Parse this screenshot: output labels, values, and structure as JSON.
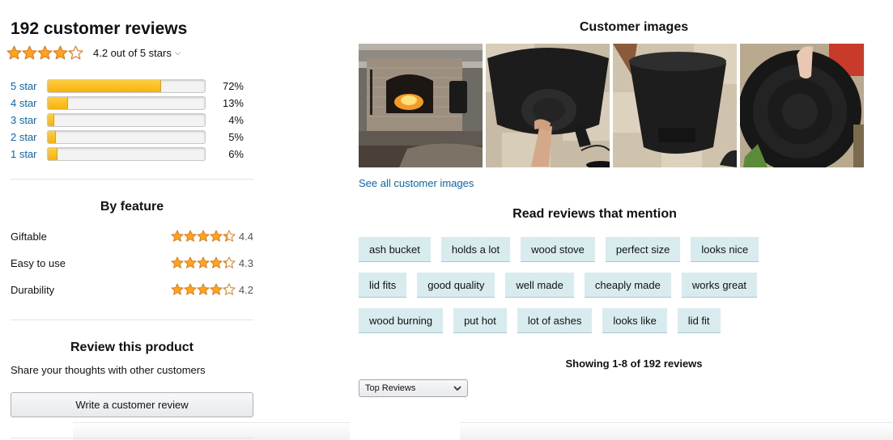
{
  "summary": {
    "total_reviews": "192 customer reviews",
    "rating_text": "4.2 out of 5 stars",
    "rating_stars": 4.2
  },
  "histogram": [
    {
      "label": "5 star",
      "percent_text": "72%",
      "fraction": 0.72
    },
    {
      "label": "4 star",
      "percent_text": "13%",
      "fraction": 0.13
    },
    {
      "label": "3 star",
      "percent_text": "4%",
      "fraction": 0.04
    },
    {
      "label": "2 star",
      "percent_text": "5%",
      "fraction": 0.05
    },
    {
      "label": "1 star",
      "percent_text": "6%",
      "fraction": 0.06
    }
  ],
  "by_feature": {
    "title": "By feature",
    "items": [
      {
        "name": "Giftable",
        "value": "4.4",
        "stars": 4.4
      },
      {
        "name": "Easy to use",
        "value": "4.3",
        "stars": 4.3
      },
      {
        "name": "Durability",
        "value": "4.2",
        "stars": 4.2
      }
    ]
  },
  "review_product": {
    "title": "Review this product",
    "subtitle": "Share your thoughts with other customers",
    "button_label": "Write a customer review"
  },
  "customer_images": {
    "title": "Customer images",
    "see_all": "See all customer images",
    "images": [
      "fireplace-photo",
      "bucket-interior-photo",
      "bucket-side-photo",
      "bucket-lid-photo"
    ]
  },
  "mentions": {
    "title": "Read reviews that mention",
    "rows": [
      [
        "ash bucket",
        "holds a lot",
        "wood stove",
        "perfect size",
        "looks nice"
      ],
      [
        "lid fits",
        "good quality",
        "well made",
        "cheaply made",
        "works great"
      ],
      [
        "wood burning",
        "put hot",
        "lot of ashes",
        "looks like",
        "lid fit"
      ]
    ]
  },
  "listing": {
    "showing": "Showing 1-8 of 192 reviews",
    "sort_selected": "Top Reviews"
  },
  "colors": {
    "star": "#ffa41c",
    "link": "#0a66b5",
    "bar_fill": "#f8b10e",
    "chip_bg": "#d8ecf0"
  }
}
